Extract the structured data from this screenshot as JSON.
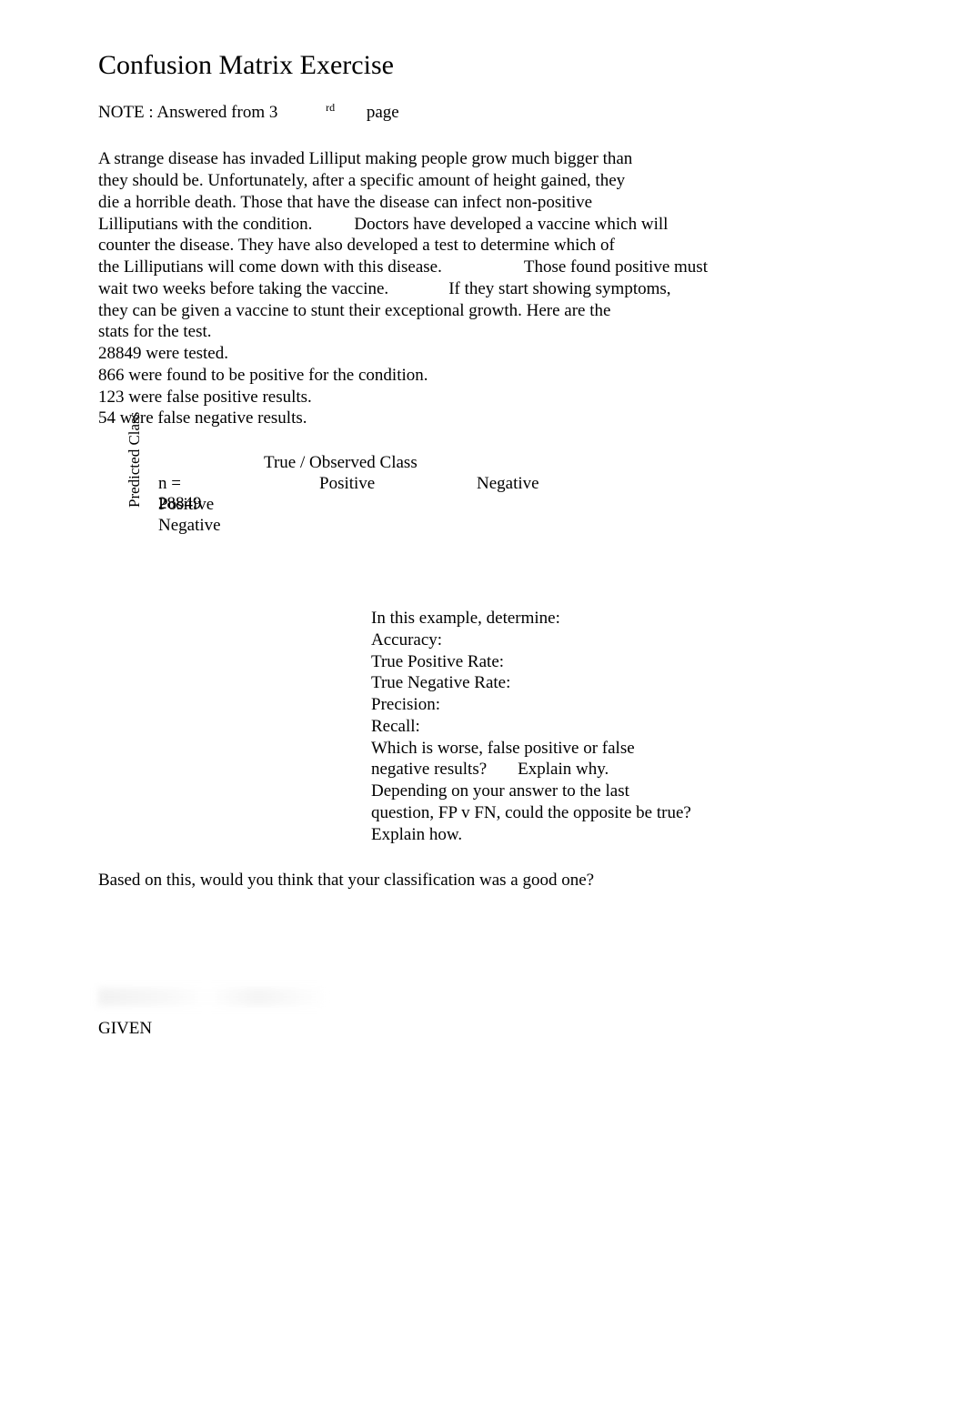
{
  "title": "Confusion Matrix Exercise",
  "note": {
    "prefix": "NOTE : Answered from 3",
    "sup": "rd",
    "suffix": "page"
  },
  "paragraph": {
    "l1": "A strange disease has invaded Lilliput making people grow much bigger than",
    "l2": "they should be. Unfortunately, after a specific amount of height gained, they",
    "l3": "die a horrible death. Those that have the disease can infect non-positive",
    "l4a": "Lilliputians with the condition.",
    "l4b": "Doctors have developed a vaccine which will",
    "l5": "counter the disease. They have also developed a test to determine which of",
    "l6a": "the Lilliputians will come down with this disease.",
    "l6b": "Those found positive must",
    "l7a": "wait two weeks before taking the vaccine.",
    "l7b": "If they start showing symptoms,",
    "l8": "they can be given a vaccine to stunt their exceptional growth. Here are the",
    "l9": "stats for the test."
  },
  "stats": {
    "s1": "28849 were tested.",
    "s2": "866 were found to be positive for the condition.",
    "s3": "123 were false positive results.",
    "s4": "54 were false negative results."
  },
  "matrix": {
    "top_header": "True / Observed Class",
    "side_header": "Predicted Class",
    "n_label": "n = 28849",
    "col_pos": "Positive",
    "col_neg": "Negative",
    "row_pos": "Positive",
    "row_neg": "Negative"
  },
  "questions": {
    "intro": "In this example, determine:",
    "q1": "Accuracy:",
    "q2": "True Positive Rate:",
    "q3": "True Negative Rate:",
    "q4": "Precision:",
    "q5": "Recall:",
    "q6a": "Which is worse, false positive or false",
    "q6b": "negative results?",
    "q6c": "Explain why.",
    "q7a": "Depending on your answer to the last",
    "q7b": "question, FP v FN, could the opposite be true?",
    "q7c": "Explain how."
  },
  "final_question": "Based on this, would you think that your classification was a good one?",
  "given": "GIVEN"
}
